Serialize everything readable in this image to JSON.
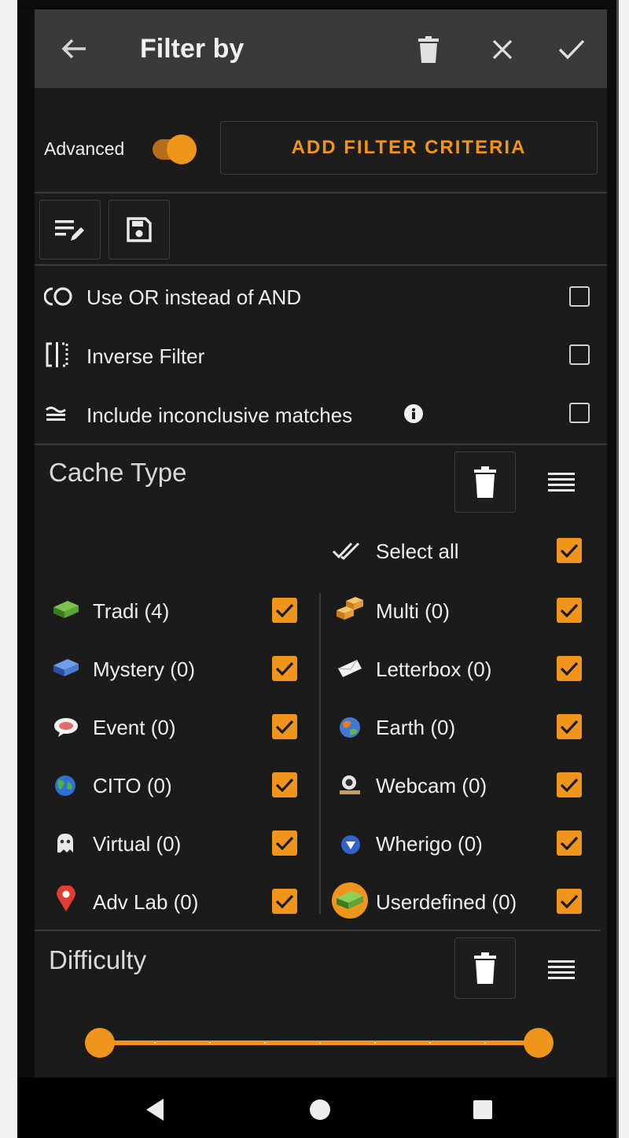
{
  "appbar": {
    "title": "Filter by"
  },
  "advanced": {
    "label": "Advanced",
    "enabled": true,
    "add_button_label": "ADD FILTER CRITERIA"
  },
  "options": [
    {
      "icon": "or-icon",
      "label": "Use OR instead of AND",
      "checked": false
    },
    {
      "icon": "inverse-icon",
      "label": "Inverse Filter",
      "checked": false
    },
    {
      "icon": "inconclusive-icon",
      "label": "Include inconclusive matches",
      "checked": false
    }
  ],
  "cache_type": {
    "title": "Cache Type",
    "select_all_label": "Select all",
    "select_all_checked": true,
    "left": [
      {
        "label": "Tradi (4)",
        "icon": "traditional-cache-icon",
        "checked": true
      },
      {
        "label": "Mystery (0)",
        "icon": "mystery-cache-icon",
        "checked": true
      },
      {
        "label": "Event (0)",
        "icon": "event-cache-icon",
        "checked": true
      },
      {
        "label": "CITO (0)",
        "icon": "cito-cache-icon",
        "checked": true
      },
      {
        "label": "Virtual (0)",
        "icon": "virtual-cache-icon",
        "checked": true
      },
      {
        "label": "Adv Lab (0)",
        "icon": "adventure-lab-icon",
        "checked": true
      }
    ],
    "right": [
      {
        "label": "Multi (0)",
        "icon": "multi-cache-icon",
        "checked": true
      },
      {
        "label": "Letterbox (0)",
        "icon": "letterbox-cache-icon",
        "checked": true
      },
      {
        "label": "Earth (0)",
        "icon": "earth-cache-icon",
        "checked": true
      },
      {
        "label": "Webcam (0)",
        "icon": "webcam-cache-icon",
        "checked": true
      },
      {
        "label": "Wherigo (0)",
        "icon": "wherigo-cache-icon",
        "checked": true
      },
      {
        "label": "Userdefined (0)",
        "icon": "userdefined-cache-icon",
        "checked": true
      }
    ]
  },
  "difficulty": {
    "title": "Difficulty",
    "range_min_fraction": 0.0,
    "range_max_fraction": 1.0
  },
  "colors": {
    "accent": "#f0951c",
    "background": "#1b1b1b",
    "appbar": "#3a3a3a"
  }
}
